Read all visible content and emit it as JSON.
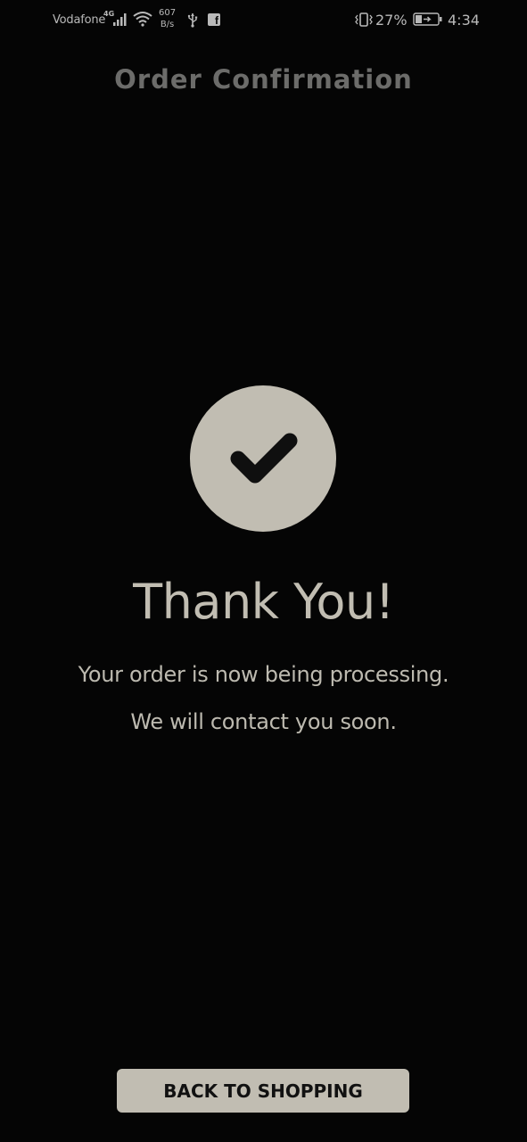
{
  "status_bar": {
    "carrier": "Vodafone",
    "network_type": "4G",
    "speed_value": "607",
    "speed_unit": "B/s",
    "battery_percent": "27%",
    "time": "4:34",
    "icons": [
      "signal-icon",
      "wifi-icon",
      "usb-icon",
      "facebook-icon",
      "vibrate-icon",
      "battery-charging-icon"
    ]
  },
  "header": {
    "title": "Order Confirmation"
  },
  "confirmation": {
    "icon": "checkmark-icon",
    "title": "Thank You!",
    "message_line_1": "Your order is now being processing.",
    "message_line_2": "We will contact you soon."
  },
  "actions": {
    "back_to_shopping_label": "BACK TO SHOPPING"
  },
  "colors": {
    "background": "#050505",
    "accent": "#c1bdb2",
    "title_gray": "#6c6c6a"
  }
}
